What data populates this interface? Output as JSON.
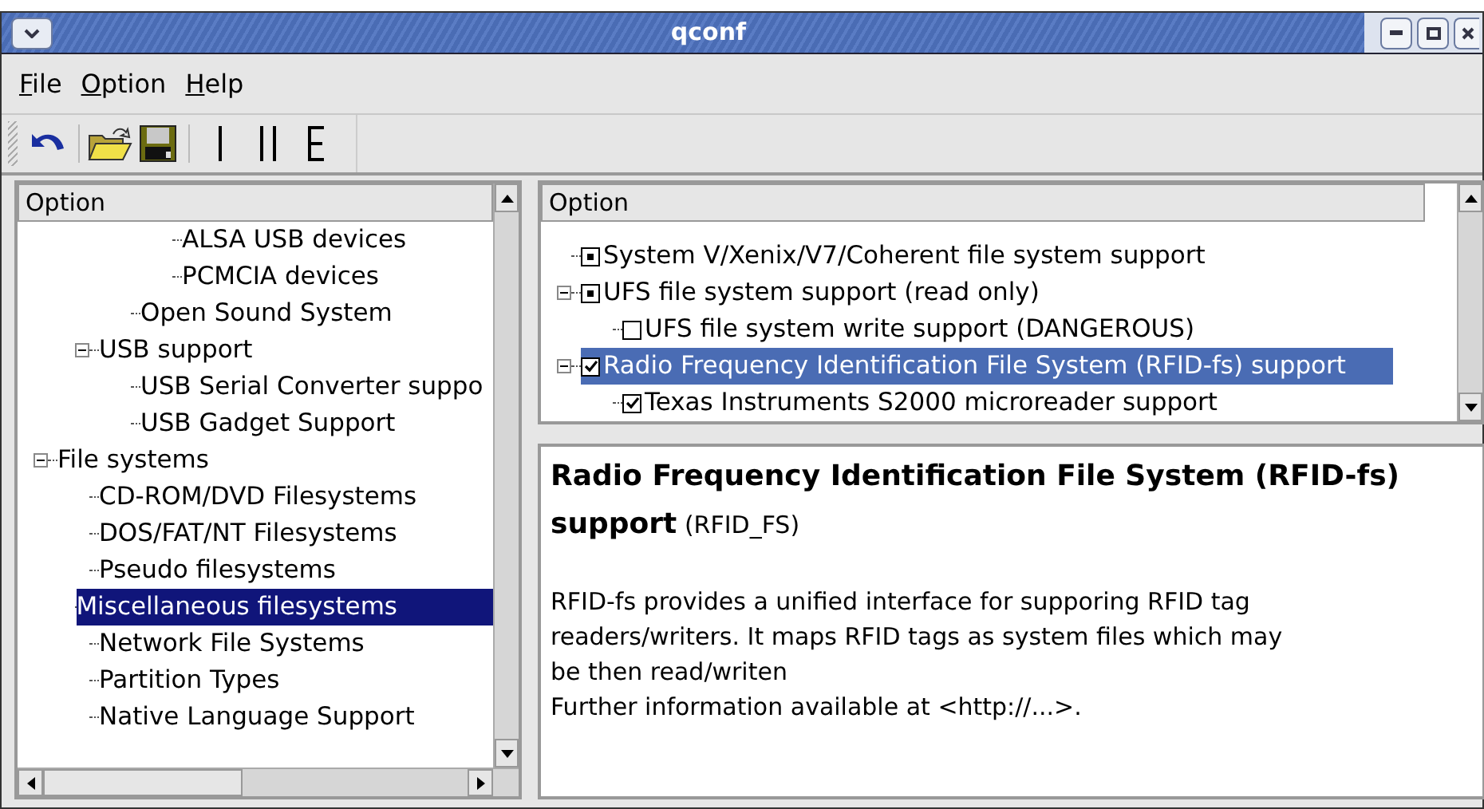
{
  "window": {
    "title": "qconf"
  },
  "menu": [
    {
      "label": "File"
    },
    {
      "label": "Option"
    },
    {
      "label": "Help"
    }
  ],
  "toolbar": [
    {
      "kind": "back"
    },
    {
      "kind": "sep"
    },
    {
      "kind": "open"
    },
    {
      "kind": "save"
    },
    {
      "kind": "sep"
    },
    {
      "kind": "single"
    },
    {
      "kind": "split"
    },
    {
      "kind": "full"
    }
  ],
  "left_tree": {
    "header": "Option",
    "items": [
      {
        "children": [
          {
            "children": [
              {
                "children": [
                  {
                    "label": "ALSA USB devices",
                    "selected": false
                  },
                  {
                    "label": "PCMCIA devices",
                    "selected": false
                  }
                ]
              },
              {
                "label": "Open Sound System",
                "selected": false
              }
            ]
          },
          {
            "label": "USB support",
            "expanded": true,
            "selected": false,
            "children": [
              {
                "label": "USB Serial Converter suppo",
                "selected": false
              },
              {
                "label": "USB Gadget Support",
                "selected": false
              }
            ]
          }
        ]
      },
      {
        "label": "File systems",
        "expanded": true,
        "selected": false,
        "children": [
          {
            "label": "CD-ROM/DVD Filesystems",
            "selected": false
          },
          {
            "label": "DOS/FAT/NT Filesystems",
            "selected": false
          },
          {
            "label": "Pseudo filesystems",
            "selected": false
          },
          {
            "label": "Miscellaneous filesystems",
            "selected": true
          },
          {
            "label": "Network File Systems",
            "selected": false
          },
          {
            "label": "Partition Types",
            "selected": false
          },
          {
            "label": "Native Language Support",
            "selected": false
          }
        ]
      }
    ]
  },
  "right_tree": {
    "header": "Option",
    "items": [
      {
        "label": "System V/Xenix/V7/Coherent file system support",
        "checked": false,
        "module": true,
        "selected": false
      },
      {
        "label": "UFS file system support (read only)",
        "checked": false,
        "module": true,
        "expanded": true,
        "selected": false,
        "children": [
          {
            "label": "UFS file system write support (DANGEROUS)",
            "checked": false,
            "module": false,
            "selected": false
          }
        ]
      },
      {
        "label": "Radio Frequency Identification File System (RFID-fs) support",
        "checked": true,
        "module": false,
        "expanded": true,
        "selected": true,
        "children": [
          {
            "label": "Texas Instruments S2000 microreader support",
            "checked": true,
            "module": false,
            "selected": false
          }
        ]
      }
    ]
  },
  "help": {
    "title": "Radio Frequency Identification File System (RFID-fs) support",
    "symbol": "(RFID_FS)",
    "lines": [
      "RFID-fs provides a unified interface for supporing RFID tag",
      "readers/writers. It maps RFID tags as system files which may",
      "be then read/writen",
      "Further information available at <http://...>."
    ]
  }
}
